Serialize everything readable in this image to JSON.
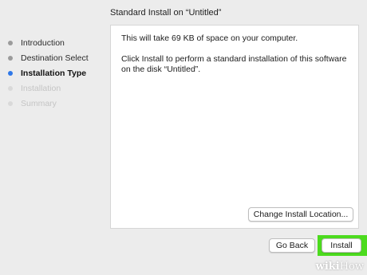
{
  "window": {
    "title": "Standard Install on “Untitled”"
  },
  "sidebar": {
    "steps": [
      {
        "label": "Introduction",
        "state": "done"
      },
      {
        "label": "Destination Select",
        "state": "done"
      },
      {
        "label": "Installation Type",
        "state": "active"
      },
      {
        "label": "Installation",
        "state": "pending"
      },
      {
        "label": "Summary",
        "state": "pending"
      }
    ]
  },
  "content": {
    "space_text": "This will take 69 KB of space on your computer.",
    "instruction_text": "Click Install to perform a standard installation of this software on the disk “Untitled”.",
    "change_location_label": "Change Install Location..."
  },
  "footer": {
    "go_back_label": "Go Back",
    "install_label": "Install"
  },
  "watermark": {
    "wiki": "wiki",
    "how": "How"
  },
  "colors": {
    "active_step": "#2f78e8",
    "highlight": "#4cdb1e"
  }
}
